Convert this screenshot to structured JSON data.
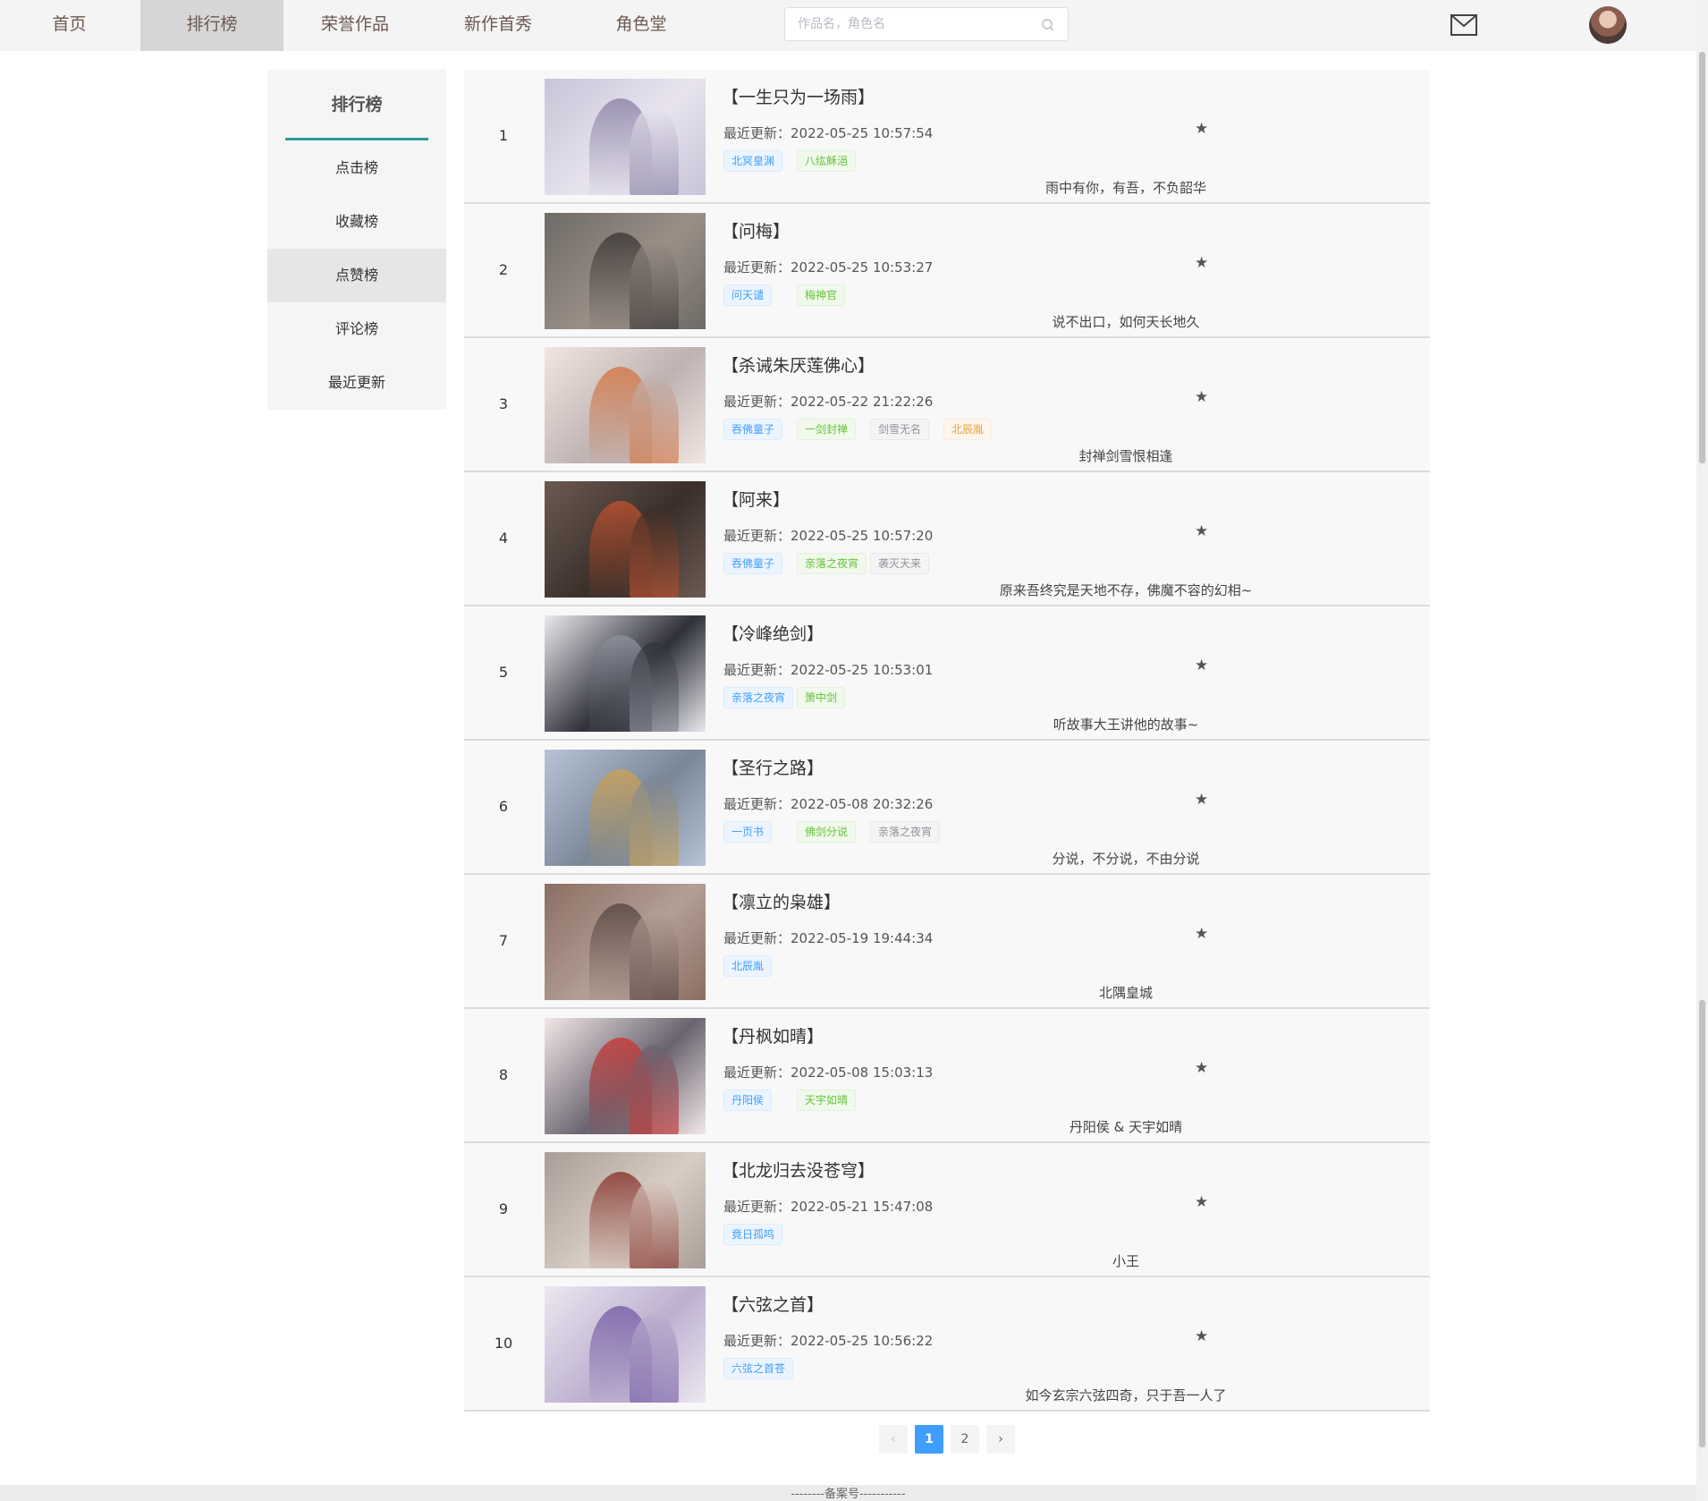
{
  "nav": {
    "items": [
      {
        "label": "首页"
      },
      {
        "label": "排行榜"
      },
      {
        "label": "荣誉作品"
      },
      {
        "label": "新作首秀"
      },
      {
        "label": "角色堂"
      }
    ],
    "active_index": 1,
    "search_placeholder": "作品名，角色名"
  },
  "sidebar": {
    "title": "排行榜",
    "items": [
      {
        "label": "点击榜"
      },
      {
        "label": "收藏榜"
      },
      {
        "label": "点赞榜"
      },
      {
        "label": "评论榜"
      },
      {
        "label": "最近更新"
      }
    ],
    "active_index": 2,
    "accent_color": "#2e9b9c"
  },
  "list": {
    "updated_prefix": "最近更新：",
    "items": [
      {
        "rank": "1",
        "title": "【一生只为一场雨】",
        "updated": "2022-05-25 10:57:54",
        "tags": [
          {
            "text": "北冥皇渊",
            "color": "blue"
          },
          {
            "text": "八纮稣浥",
            "color": "green"
          }
        ],
        "desc": "雨中有你，有吾，不负韶华"
      },
      {
        "rank": "2",
        "title": "【问梅】",
        "updated": "2022-05-25 10:53:27",
        "tags": [
          {
            "text": "问天谴",
            "color": "blue"
          },
          {
            "text": "梅神官",
            "color": "green"
          }
        ],
        "desc": "说不出口，如何天长地久"
      },
      {
        "rank": "3",
        "title": "【杀诫朱厌莲佛心】",
        "updated": "2022-05-22 21:22:26",
        "tags": [
          {
            "text": "吞佛童子",
            "color": "blue"
          },
          {
            "text": "一剑封禅",
            "color": "green"
          },
          {
            "text": "剑雪无名",
            "color": "gray"
          },
          {
            "text": "北辰胤",
            "color": "orange"
          }
        ],
        "desc": "封禅剑雪恨相逢"
      },
      {
        "rank": "4",
        "title": "【阿来】",
        "updated": "2022-05-25 10:57:20",
        "tags": [
          {
            "text": "吞佛童子",
            "color": "blue"
          },
          {
            "text": "亲落之夜宵",
            "color": "green"
          },
          {
            "text": "袭灭天来",
            "color": "gray"
          }
        ],
        "desc": "原来吾终究是天地不存，佛魔不容的幻相~"
      },
      {
        "rank": "5",
        "title": "【冷峰绝剑】",
        "updated": "2022-05-25 10:53:01",
        "tags": [
          {
            "text": "亲落之夜宵",
            "color": "blue"
          },
          {
            "text": "箫中剑",
            "color": "green"
          }
        ],
        "desc": "听故事大王讲他的故事~"
      },
      {
        "rank": "6",
        "title": "【圣行之路】",
        "updated": "2022-05-08 20:32:26",
        "tags": [
          {
            "text": "一页书",
            "color": "blue"
          },
          {
            "text": "佛剑分说",
            "color": "green"
          },
          {
            "text": "亲落之夜宵",
            "color": "gray"
          }
        ],
        "desc": "分说，不分说，不由分说"
      },
      {
        "rank": "7",
        "title": "【凛立的枭雄】",
        "updated": "2022-05-19 19:44:34",
        "tags": [
          {
            "text": "北辰胤",
            "color": "blue"
          }
        ],
        "desc": "北隅皇城"
      },
      {
        "rank": "8",
        "title": "【丹枫如晴】",
        "updated": "2022-05-08 15:03:13",
        "tags": [
          {
            "text": "丹阳侯",
            "color": "blue"
          },
          {
            "text": "天宇如晴",
            "color": "green"
          }
        ],
        "desc": "丹阳侯 & 天宇如晴"
      },
      {
        "rank": "9",
        "title": "【北龙归去没苍穹】",
        "updated": "2022-05-21 15:47:08",
        "tags": [
          {
            "text": "竟日孤鸣",
            "color": "blue"
          }
        ],
        "desc": "小王"
      },
      {
        "rank": "10",
        "title": "【六弦之首】",
        "updated": "2022-05-25 10:56:22",
        "tags": [
          {
            "text": "六弦之首苍",
            "color": "blue"
          }
        ],
        "desc": "如今玄宗六弦四奇，只于吾一人了"
      }
    ]
  },
  "pagination": {
    "prev": "‹",
    "pages": [
      "1",
      "2"
    ],
    "current": "1",
    "next": "›"
  },
  "footer": {
    "text": "--------备案号-----------"
  }
}
